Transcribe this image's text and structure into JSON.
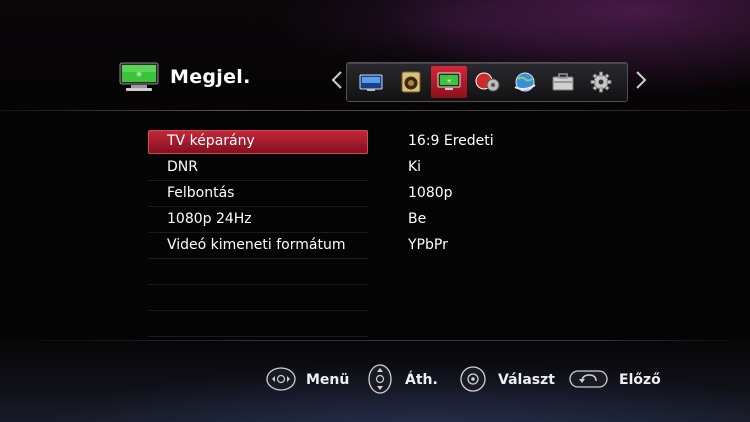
{
  "header": {
    "title": "Megjel.",
    "icon": "monitor-icon"
  },
  "tabs": [
    {
      "icon": "tv-broadcast-icon",
      "active": false
    },
    {
      "icon": "speaker-icon",
      "active": false
    },
    {
      "icon": "display-icon",
      "active": true
    },
    {
      "icon": "lock-settings-icon",
      "active": false
    },
    {
      "icon": "globe-network-icon",
      "active": false
    },
    {
      "icon": "briefcase-icon",
      "active": false
    },
    {
      "icon": "gear-icon",
      "active": false
    }
  ],
  "menu": {
    "items": [
      {
        "label": "TV képarány",
        "value": "16:9 Eredeti",
        "selected": true
      },
      {
        "label": "DNR",
        "value": "Ki",
        "selected": false
      },
      {
        "label": "Felbontás",
        "value": "1080p",
        "selected": false
      },
      {
        "label": "1080p 24Hz",
        "value": "Be",
        "selected": false
      },
      {
        "label": "Videó kimeneti formátum",
        "value": "YPbPr",
        "selected": false
      }
    ]
  },
  "footer": {
    "menu_label": "Menü",
    "move_label": "Áth.",
    "select_label": "Választ",
    "back_label": "Előző"
  },
  "colors": {
    "accent_red": "#c8283c",
    "background": "#050405"
  }
}
